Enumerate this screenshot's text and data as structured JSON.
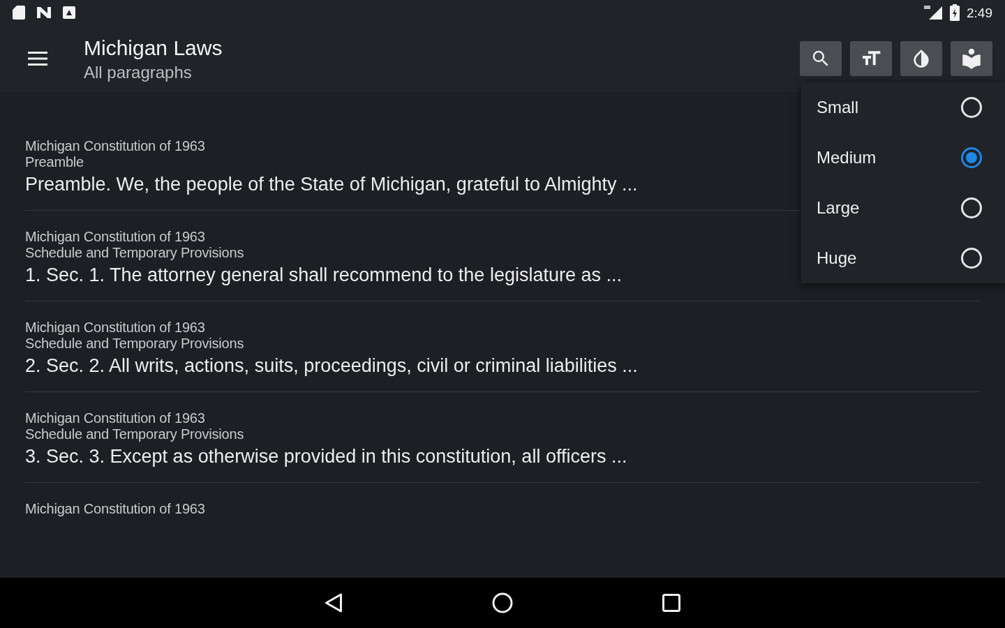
{
  "status_bar": {
    "time": "2:49"
  },
  "app_bar": {
    "title": "Michigan Laws",
    "subtitle": "All paragraphs"
  },
  "paragraphs": [
    {
      "source": "Michigan Constitution of 1963",
      "section": "Preamble",
      "text": "Preamble. We, the people of the State of Michigan, grateful to Almighty ..."
    },
    {
      "source": "Michigan Constitution of 1963",
      "section": "Schedule and Temporary Provisions",
      "text": "1. Sec. 1. The attorney general shall recommend to the legislature as ..."
    },
    {
      "source": "Michigan Constitution of 1963",
      "section": "Schedule and Temporary Provisions",
      "text": "2. Sec. 2. All writs, actions, suits, proceedings, civil or criminal liabilities ..."
    },
    {
      "source": "Michigan Constitution of 1963",
      "section": "Schedule and Temporary Provisions",
      "text": "3. Sec. 3. Except as otherwise provided in this constitution, all officers ..."
    },
    {
      "source": "Michigan Constitution of 1963"
    }
  ],
  "text_size_menu": {
    "options": [
      {
        "label": "Small",
        "selected": false
      },
      {
        "label": "Medium",
        "selected": true
      },
      {
        "label": "Large",
        "selected": false
      },
      {
        "label": "Huge",
        "selected": false
      }
    ]
  }
}
